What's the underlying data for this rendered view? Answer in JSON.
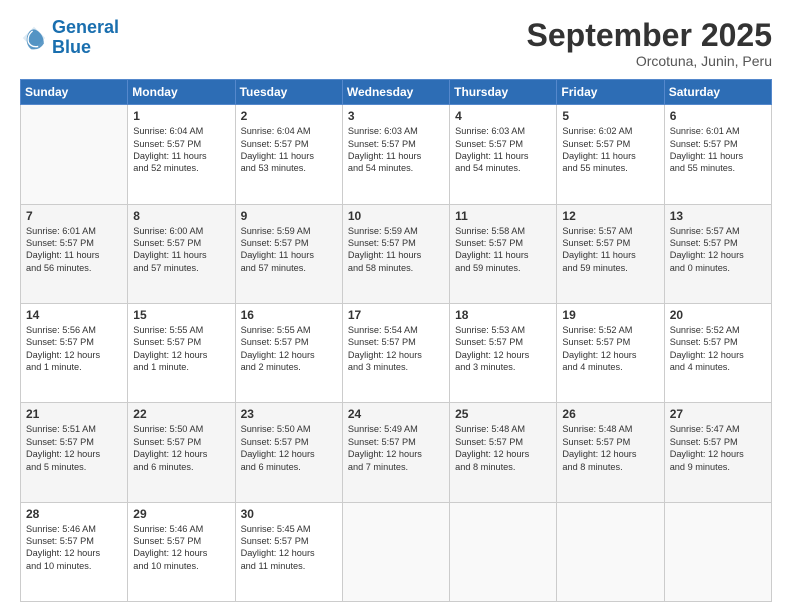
{
  "logo": {
    "line1": "General",
    "line2": "Blue"
  },
  "title": "September 2025",
  "subtitle": "Orcotuna, Junin, Peru",
  "header_days": [
    "Sunday",
    "Monday",
    "Tuesday",
    "Wednesday",
    "Thursday",
    "Friday",
    "Saturday"
  ],
  "weeks": [
    [
      {
        "day": "",
        "info": ""
      },
      {
        "day": "1",
        "info": "Sunrise: 6:04 AM\nSunset: 5:57 PM\nDaylight: 11 hours\nand 52 minutes."
      },
      {
        "day": "2",
        "info": "Sunrise: 6:04 AM\nSunset: 5:57 PM\nDaylight: 11 hours\nand 53 minutes."
      },
      {
        "day": "3",
        "info": "Sunrise: 6:03 AM\nSunset: 5:57 PM\nDaylight: 11 hours\nand 54 minutes."
      },
      {
        "day": "4",
        "info": "Sunrise: 6:03 AM\nSunset: 5:57 PM\nDaylight: 11 hours\nand 54 minutes."
      },
      {
        "day": "5",
        "info": "Sunrise: 6:02 AM\nSunset: 5:57 PM\nDaylight: 11 hours\nand 55 minutes."
      },
      {
        "day": "6",
        "info": "Sunrise: 6:01 AM\nSunset: 5:57 PM\nDaylight: 11 hours\nand 55 minutes."
      }
    ],
    [
      {
        "day": "7",
        "info": "Sunrise: 6:01 AM\nSunset: 5:57 PM\nDaylight: 11 hours\nand 56 minutes."
      },
      {
        "day": "8",
        "info": "Sunrise: 6:00 AM\nSunset: 5:57 PM\nDaylight: 11 hours\nand 57 minutes."
      },
      {
        "day": "9",
        "info": "Sunrise: 5:59 AM\nSunset: 5:57 PM\nDaylight: 11 hours\nand 57 minutes."
      },
      {
        "day": "10",
        "info": "Sunrise: 5:59 AM\nSunset: 5:57 PM\nDaylight: 11 hours\nand 58 minutes."
      },
      {
        "day": "11",
        "info": "Sunrise: 5:58 AM\nSunset: 5:57 PM\nDaylight: 11 hours\nand 59 minutes."
      },
      {
        "day": "12",
        "info": "Sunrise: 5:57 AM\nSunset: 5:57 PM\nDaylight: 11 hours\nand 59 minutes."
      },
      {
        "day": "13",
        "info": "Sunrise: 5:57 AM\nSunset: 5:57 PM\nDaylight: 12 hours\nand 0 minutes."
      }
    ],
    [
      {
        "day": "14",
        "info": "Sunrise: 5:56 AM\nSunset: 5:57 PM\nDaylight: 12 hours\nand 1 minute."
      },
      {
        "day": "15",
        "info": "Sunrise: 5:55 AM\nSunset: 5:57 PM\nDaylight: 12 hours\nand 1 minute."
      },
      {
        "day": "16",
        "info": "Sunrise: 5:55 AM\nSunset: 5:57 PM\nDaylight: 12 hours\nand 2 minutes."
      },
      {
        "day": "17",
        "info": "Sunrise: 5:54 AM\nSunset: 5:57 PM\nDaylight: 12 hours\nand 3 minutes."
      },
      {
        "day": "18",
        "info": "Sunrise: 5:53 AM\nSunset: 5:57 PM\nDaylight: 12 hours\nand 3 minutes."
      },
      {
        "day": "19",
        "info": "Sunrise: 5:52 AM\nSunset: 5:57 PM\nDaylight: 12 hours\nand 4 minutes."
      },
      {
        "day": "20",
        "info": "Sunrise: 5:52 AM\nSunset: 5:57 PM\nDaylight: 12 hours\nand 4 minutes."
      }
    ],
    [
      {
        "day": "21",
        "info": "Sunrise: 5:51 AM\nSunset: 5:57 PM\nDaylight: 12 hours\nand 5 minutes."
      },
      {
        "day": "22",
        "info": "Sunrise: 5:50 AM\nSunset: 5:57 PM\nDaylight: 12 hours\nand 6 minutes."
      },
      {
        "day": "23",
        "info": "Sunrise: 5:50 AM\nSunset: 5:57 PM\nDaylight: 12 hours\nand 6 minutes."
      },
      {
        "day": "24",
        "info": "Sunrise: 5:49 AM\nSunset: 5:57 PM\nDaylight: 12 hours\nand 7 minutes."
      },
      {
        "day": "25",
        "info": "Sunrise: 5:48 AM\nSunset: 5:57 PM\nDaylight: 12 hours\nand 8 minutes."
      },
      {
        "day": "26",
        "info": "Sunrise: 5:48 AM\nSunset: 5:57 PM\nDaylight: 12 hours\nand 8 minutes."
      },
      {
        "day": "27",
        "info": "Sunrise: 5:47 AM\nSunset: 5:57 PM\nDaylight: 12 hours\nand 9 minutes."
      }
    ],
    [
      {
        "day": "28",
        "info": "Sunrise: 5:46 AM\nSunset: 5:57 PM\nDaylight: 12 hours\nand 10 minutes."
      },
      {
        "day": "29",
        "info": "Sunrise: 5:46 AM\nSunset: 5:57 PM\nDaylight: 12 hours\nand 10 minutes."
      },
      {
        "day": "30",
        "info": "Sunrise: 5:45 AM\nSunset: 5:57 PM\nDaylight: 12 hours\nand 11 minutes."
      },
      {
        "day": "",
        "info": ""
      },
      {
        "day": "",
        "info": ""
      },
      {
        "day": "",
        "info": ""
      },
      {
        "day": "",
        "info": ""
      }
    ]
  ]
}
